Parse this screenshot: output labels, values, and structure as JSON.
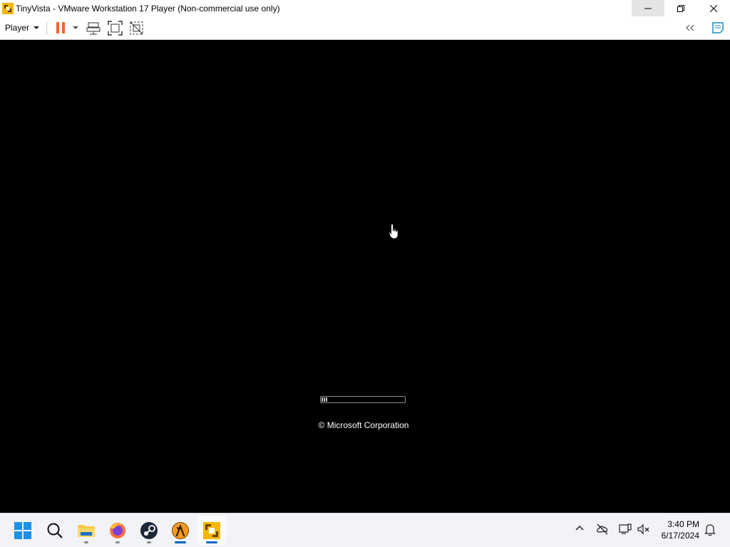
{
  "window": {
    "title": "TinyVista - VMware Workstation 17 Player (Non-commercial use only)"
  },
  "toolbar": {
    "player_menu_label": "Player"
  },
  "vm": {
    "boot_progress_label": "© Microsoft Corporation"
  },
  "taskbar": {
    "apps": [
      "start",
      "search",
      "file-explorer",
      "firefox",
      "steam",
      "half-life",
      "vmware-player"
    ],
    "clock_time": "3:40 PM",
    "clock_date": "6/17/2024"
  },
  "colors": {
    "accent": "#0067c0",
    "pause": "#e8692e",
    "vmware": "#f5b700"
  }
}
